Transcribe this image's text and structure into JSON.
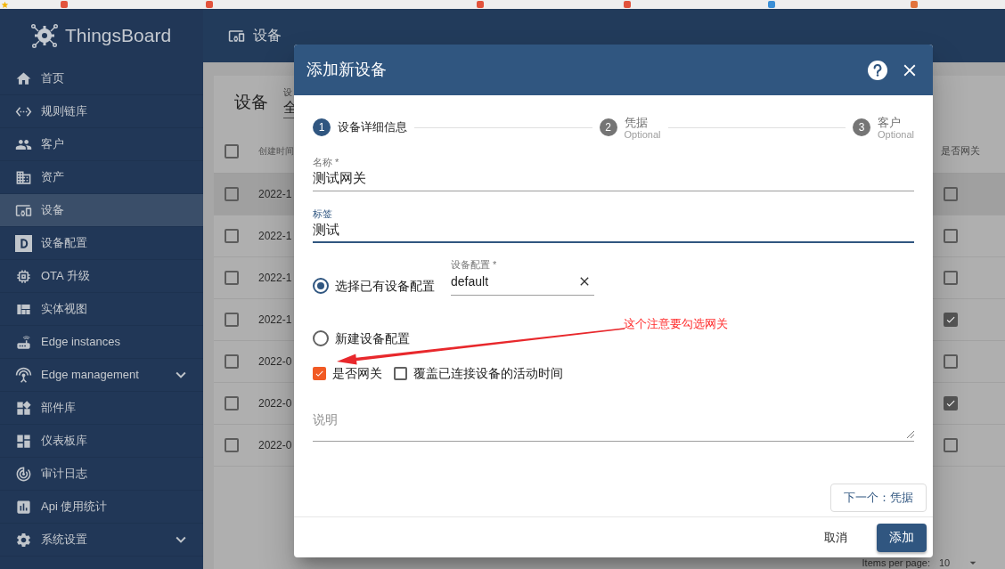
{
  "sidebar": {
    "logo": "ThingsBoard",
    "items": [
      {
        "label": "首页",
        "selected": false,
        "expandable": false
      },
      {
        "label": "规则链库",
        "selected": false,
        "expandable": false
      },
      {
        "label": "客户",
        "selected": false,
        "expandable": false
      },
      {
        "label": "资产",
        "selected": false,
        "expandable": false
      },
      {
        "label": "设备",
        "selected": true,
        "expandable": false
      },
      {
        "label": "设备配置",
        "selected": false,
        "expandable": false
      },
      {
        "label": "OTA 升级",
        "selected": false,
        "expandable": false
      },
      {
        "label": "实体视图",
        "selected": false,
        "expandable": false
      },
      {
        "label": "Edge instances",
        "selected": false,
        "expandable": false
      },
      {
        "label": "Edge management",
        "selected": false,
        "expandable": true
      },
      {
        "label": "部件库",
        "selected": false,
        "expandable": false
      },
      {
        "label": "仪表板库",
        "selected": false,
        "expandable": false
      },
      {
        "label": "审计日志",
        "selected": false,
        "expandable": false
      },
      {
        "label": "Api 使用统计",
        "selected": false,
        "expandable": false
      },
      {
        "label": "系统设置",
        "selected": false,
        "expandable": true
      }
    ]
  },
  "toolbar": {
    "title": "设备"
  },
  "device_list": {
    "title": "设备",
    "filter_label": "设",
    "filter_value": "全",
    "all_checked": false,
    "columns": [
      "创建时间",
      "是否网关"
    ],
    "rows": [
      {
        "checked": false,
        "created": "2022-1",
        "gateway": false,
        "hovered": true
      },
      {
        "checked": false,
        "created": "2022-1",
        "gateway": false,
        "hovered": false
      },
      {
        "checked": false,
        "created": "2022-1",
        "gateway": false,
        "hovered": false
      },
      {
        "checked": false,
        "created": "2022-1",
        "gateway": true,
        "hovered": false
      },
      {
        "checked": false,
        "created": "2022-0",
        "gateway": false,
        "hovered": false
      },
      {
        "checked": false,
        "created": "2022-0",
        "gateway": true,
        "hovered": false
      },
      {
        "checked": false,
        "created": "2022-0",
        "gateway": false,
        "hovered": false
      }
    ],
    "paginator": {
      "label": "Items per page:",
      "value": "10"
    }
  },
  "dialog": {
    "title": "添加新设备",
    "steps": [
      {
        "number": "1",
        "label": "设备详细信息",
        "selected": true
      },
      {
        "number": "2",
        "label": "凭据",
        "hint": "Optional",
        "selected": false
      },
      {
        "number": "3",
        "label": "客户",
        "hint": "Optional",
        "selected": false
      }
    ],
    "fields": {
      "name": {
        "label": "名称 *",
        "value": "测试网关",
        "focused": false
      },
      "tag": {
        "label": "标签",
        "value": "测试",
        "focused": true
      }
    },
    "profile_options": [
      {
        "label": "选择已有设备配置",
        "selected": true,
        "field": {
          "label": "设备配置 *",
          "value": "default"
        }
      },
      {
        "label": "新建设备配置",
        "selected": false
      }
    ],
    "checkboxes": [
      {
        "label": "是否网关",
        "checked": true
      },
      {
        "label": "覆盖已连接设备的活动时间",
        "checked": false
      }
    ],
    "description": {
      "placeholder": "说明"
    },
    "next_button": "下一个：凭据",
    "cancel_button": "取消",
    "add_button": "添加"
  },
  "annotation": {
    "text": "这个注意要勾选网关"
  }
}
